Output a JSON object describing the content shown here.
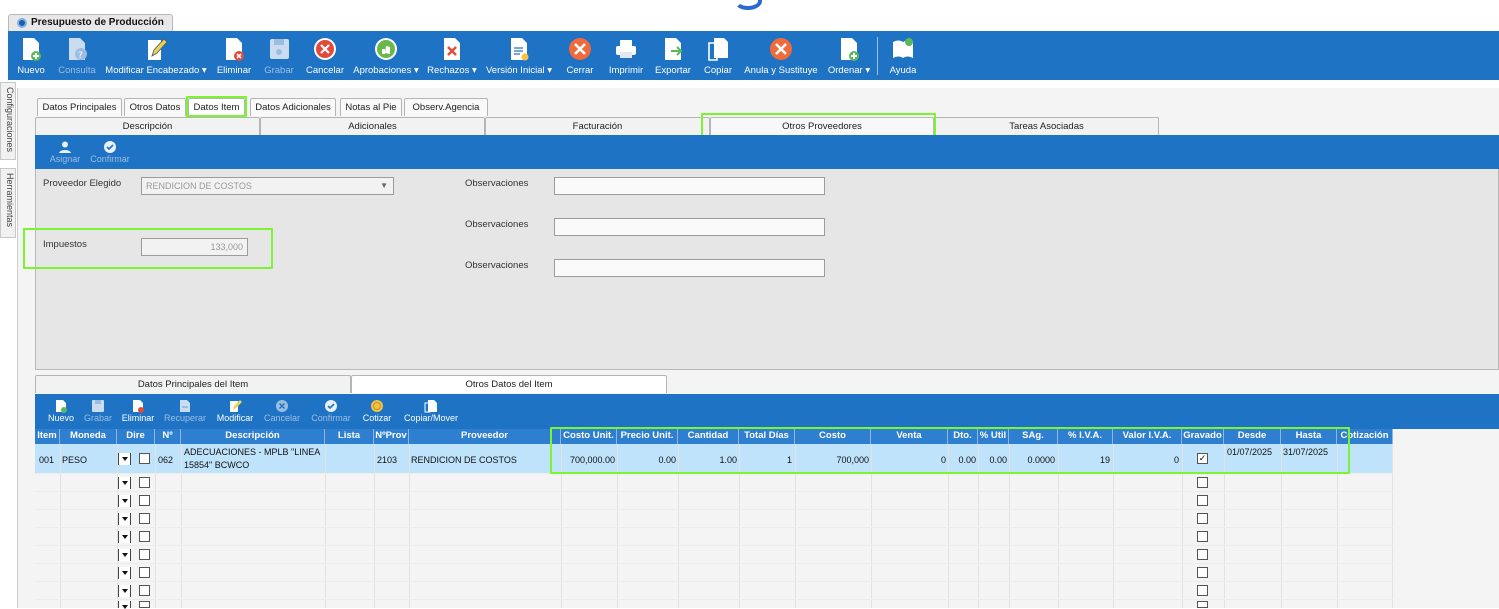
{
  "window": {
    "title": "Presupuesto de Producción"
  },
  "toolbar": {
    "buttons": [
      {
        "label": "Nuevo",
        "icon": "new-doc-icon"
      },
      {
        "label": "Consulta",
        "icon": "query-icon"
      },
      {
        "label": "Modificar Encabezado ▾",
        "icon": "edit-icon"
      },
      {
        "label": "Eliminar",
        "icon": "delete-doc-icon"
      },
      {
        "label": "Grabar",
        "icon": "save-icon"
      },
      {
        "label": "Cancelar",
        "icon": "cancel-icon"
      },
      {
        "label": "Aprobaciones ▾",
        "icon": "approve-icon"
      },
      {
        "label": "Rechazos ▾",
        "icon": "reject-icon"
      },
      {
        "label": "Versión Inicial ▾",
        "icon": "version-icon"
      },
      {
        "label": "Cerrar",
        "icon": "close-icon"
      },
      {
        "label": "Imprimir",
        "icon": "print-icon"
      },
      {
        "label": "Exportar",
        "icon": "export-icon"
      },
      {
        "label": "Copiar",
        "icon": "copy-icon"
      },
      {
        "label": "Anula y Sustituye",
        "icon": "void-icon"
      },
      {
        "label": "Ordenar ▾",
        "icon": "order-icon"
      },
      {
        "label": "Ayuda",
        "icon": "help-icon"
      }
    ]
  },
  "side_tabs": {
    "config": "Configuraciones",
    "tools": "Herramientas"
  },
  "tabs": [
    "Datos Principales",
    "Otros Datos",
    "Datos Item",
    "Datos Adicionales",
    "Notas al Pie",
    "Observ.Agencia"
  ],
  "subtabs": [
    "Descripción",
    "Adicionales",
    "Facturación",
    "Otros Proveedores",
    "Tareas Asociadas"
  ],
  "provider_bar": {
    "assign": "Asignar",
    "confirm": "Confirmar"
  },
  "form": {
    "provider_label": "Proveedor Elegido",
    "provider_value": "RENDICION DE COSTOS",
    "taxes_label": "Impuestos",
    "taxes_value": "133,000",
    "obs_label": "Observaciones"
  },
  "bottom_tabs": [
    "Datos Principales del Item",
    "Otros Datos del Item"
  ],
  "item_bar": [
    "Nuevo",
    "Grabar",
    "Eliminar",
    "Recuperar",
    "Modificar",
    "Cancelar",
    "Confirmar",
    "Cotizar",
    "Copiar/Mover"
  ],
  "grid": {
    "columns": [
      "Item",
      "Moneda",
      "Dire",
      "Nº",
      "Descripción",
      "Lista",
      "NºProv",
      "Proveedor",
      "Costo Unit.",
      "Precio Unit.",
      "Cantidad",
      "Total Días",
      "Costo",
      "Venta",
      "Dto.",
      "% Util",
      "SAg.",
      "% I.V.A.",
      "Valor I.V.A.",
      "Gravado",
      "Desde",
      "Hasta",
      "Cotización"
    ],
    "row": {
      "item": "001",
      "moneda": "PESO",
      "nro": "062",
      "desc_line1": "ADECUACIONES   - MPLB \"LINEA",
      "desc_line2": "15854\" BCWCO",
      "nprov": "2103",
      "proveedor": "RENDICION DE COSTOS",
      "costo_unit": "700,000.00",
      "precio_unit": "0.00",
      "cantidad": "1.00",
      "total_dias": "1",
      "costo": "700,000",
      "venta": "0",
      "dto": "0.00",
      "util": "0.00",
      "sag": "0.0000",
      "iva": "19",
      "valor_iva": "0",
      "gravado": "✓",
      "desde": "01/07/2025",
      "hasta": "31/07/2025"
    }
  },
  "colors": {
    "accent": "#1e73c4",
    "highlight": "#7cf531",
    "selected_row": "#bfe3fb"
  }
}
